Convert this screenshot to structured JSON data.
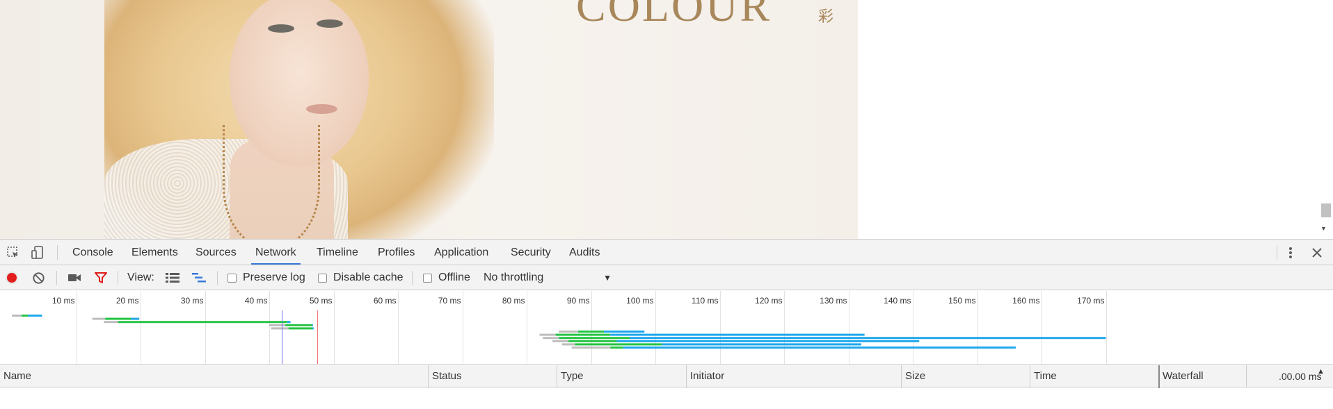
{
  "page": {
    "brand": "COLOUR",
    "brand_cn": "彩"
  },
  "devtools": {
    "tabs": [
      {
        "label": "Console",
        "active": false
      },
      {
        "label": "Elements",
        "active": false
      },
      {
        "label": "Sources",
        "active": false
      },
      {
        "label": "Network",
        "active": true
      },
      {
        "label": "Timeline",
        "active": false
      },
      {
        "label": "Profiles",
        "active": false
      },
      {
        "label": "Application",
        "active": false
      },
      {
        "label": "Security",
        "active": false
      },
      {
        "label": "Audits",
        "active": false
      }
    ],
    "toolbar": {
      "view_label": "View:",
      "preserve_log": "Preserve log",
      "disable_cache": "Disable cache",
      "offline": "Offline",
      "throttling": "No throttling"
    },
    "overview": {
      "ticks": [
        "10 ms",
        "20 ms",
        "30 ms",
        "40 ms",
        "50 ms",
        "60 ms",
        "70 ms",
        "80 ms",
        "90 ms",
        "100 ms",
        "110 ms",
        "120 ms",
        "130 ms",
        "140 ms",
        "150 ms",
        "160 ms",
        "170 ms"
      ],
      "dom_content_loaded_ms": 42,
      "load_ms": 47.5,
      "requests": [
        {
          "wait_start": 0,
          "start": 1.5,
          "green_end": 2.5,
          "end": 4.7
        },
        {
          "wait_start": 12.5,
          "start": 14.5,
          "green_end": 18.5,
          "end": 19.8
        },
        {
          "wait_start": 14.3,
          "start": 16.5,
          "green_end": 42.8,
          "end": 43.3
        },
        {
          "wait_start": 40,
          "start": 42.5,
          "green_end": 46.6,
          "end": 46.8
        },
        {
          "wait_start": 40.3,
          "start": 43,
          "green_end": 46.7,
          "end": 46.9
        },
        {
          "wait_start": 85,
          "start": 88,
          "green_end": 92,
          "end": 98.3
        },
        {
          "wait_start": 82,
          "start": 84.5,
          "green_end": 93,
          "end": 132.5
        },
        {
          "wait_start": 82.5,
          "start": 85,
          "green_end": 96,
          "end": 170
        },
        {
          "wait_start": 84,
          "start": 86.5,
          "green_end": 94,
          "end": 141
        },
        {
          "wait_start": 85.5,
          "start": 87.5,
          "green_end": 101,
          "end": 132
        },
        {
          "wait_start": 87,
          "start": 93,
          "green_end": 95,
          "end": 156
        }
      ]
    },
    "columns": [
      "Name",
      "Status",
      "Type",
      "Initiator",
      "Size",
      "Time",
      "Waterfall"
    ],
    "waterfall_time": ".00.00 ms"
  }
}
